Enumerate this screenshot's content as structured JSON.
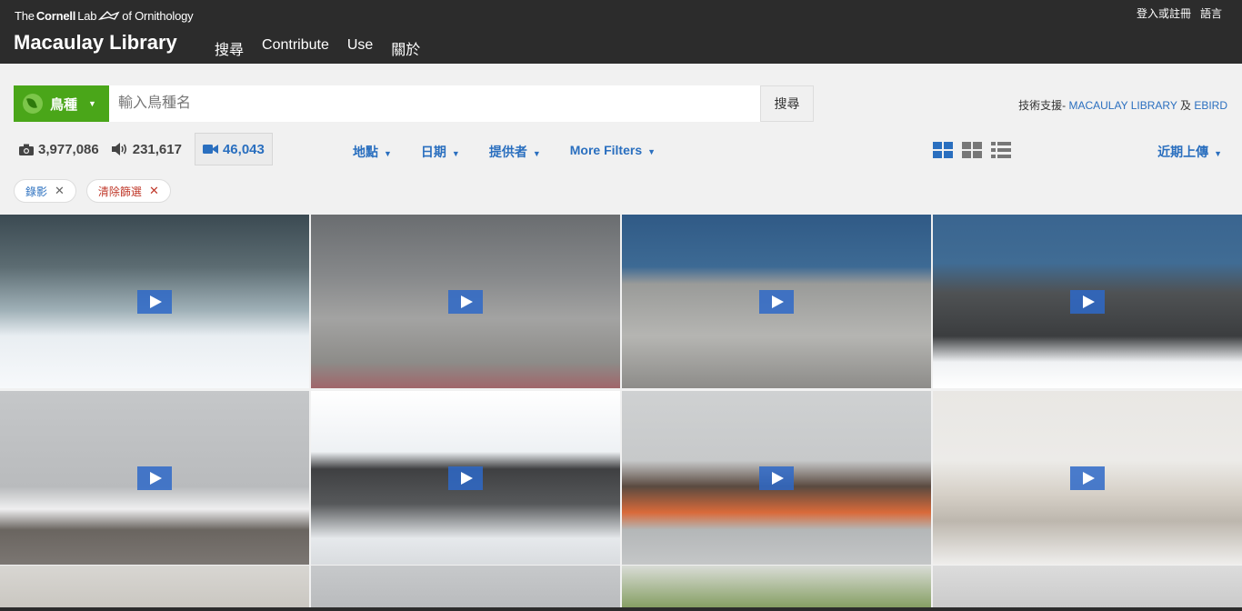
{
  "header": {
    "cornell_the": "The",
    "cornell_name": "Cornell",
    "cornell_lab": "Lab",
    "cornell_of": "of Ornithology",
    "brand": "Macaulay Library",
    "nav": [
      "搜尋",
      "Contribute",
      "Use",
      "關於"
    ],
    "login": "登入或註冊",
    "language": "語言"
  },
  "search": {
    "taxon_label": "鳥種",
    "placeholder": "輸入鳥種名",
    "button": "搜尋",
    "powered_prefix": "技術支援- ",
    "powered_link1": "MACAULAY LIBRARY",
    "powered_and": " 及 ",
    "powered_link2": "EBIRD"
  },
  "stats": {
    "photos": "3,977,086",
    "audio": "231,617",
    "video": "46,043"
  },
  "filters": {
    "location": "地點",
    "date": "日期",
    "contributor": "提供者",
    "more": "More Filters",
    "sort": "近期上傳"
  },
  "tags": {
    "video": "錄影",
    "clear": "清除篩選"
  },
  "colors": {
    "header_bg": "#2c2c2c",
    "accent_blue": "#2a6fbf",
    "taxon_green": "#4aa619",
    "clear_red": "#c0392b"
  },
  "tiles": [
    {
      "scene": "icy water with snow",
      "bg": "linear-gradient(180deg,#3b4a52 0%,#5c6c72 30%,#9fb0b7 55%,#e9eef2 70%,#f7f9fb 100%)"
    },
    {
      "scene": "two white birds on rock",
      "bg": "linear-gradient(180deg,#6a6d70 0%,#86888a 35%,#a3a3a2 60%,#8d8c89 85%,#a0666a 100%)"
    },
    {
      "scene": "white bird on rock by water",
      "bg": "linear-gradient(180deg,#305a86 0%,#3d6a94 30%,#9a9b99 40%,#b5b5b2 70%,#8d8c89 100%)"
    },
    {
      "scene": "dark rocks and snow",
      "bg": "linear-gradient(180deg,#3a6590 0%,#406c94 28%,#4f5254 45%,#3b3d3f 70%,#f0f2f4 85%,#ffffff 100%)"
    },
    {
      "scene": "seal by wooden crate",
      "bg": "linear-gradient(180deg,#c5c7c9 0%,#b9bbbd 55%,#efeff0 68%,#6a6560 80%,#7b7672 100%)"
    },
    {
      "scene": "seal on snow",
      "bg": "linear-gradient(180deg,#ffffff 0%,#eef1f4 35%,#3f4042 45%,#56585a 65%,#e6e9ec 85%,#d9dcdf 100%)"
    },
    {
      "scene": "pelicans on buoy line",
      "bg": "linear-gradient(180deg,#cfd1d2 0%,#c7c9ca 40%,#5a4a40 55%,#d96a3a 70%,#b4b7b8 80%,#c4c6c7 100%)"
    },
    {
      "scene": "shorebird on sand",
      "bg": "linear-gradient(180deg,#e9e7e4 0%,#ecebe8 40%,#d5cfc6 60%,#bdb7ae 75%,#efeeec 100%)"
    },
    {
      "scene": "sand",
      "bg": "linear-gradient(180deg,#d8d6d2 0%,#c9c6c0 100%)"
    },
    {
      "scene": "blurred",
      "bg": "linear-gradient(180deg,#c7c9cb 0%,#b8babc 100%)"
    },
    {
      "scene": "grass",
      "bg": "linear-gradient(180deg,#d9dcd6 0%,#7f9a5a 100%)"
    },
    {
      "scene": "blurred",
      "bg": "linear-gradient(180deg,#dcdcdc 0%,#c9c9c9 100%)"
    }
  ]
}
